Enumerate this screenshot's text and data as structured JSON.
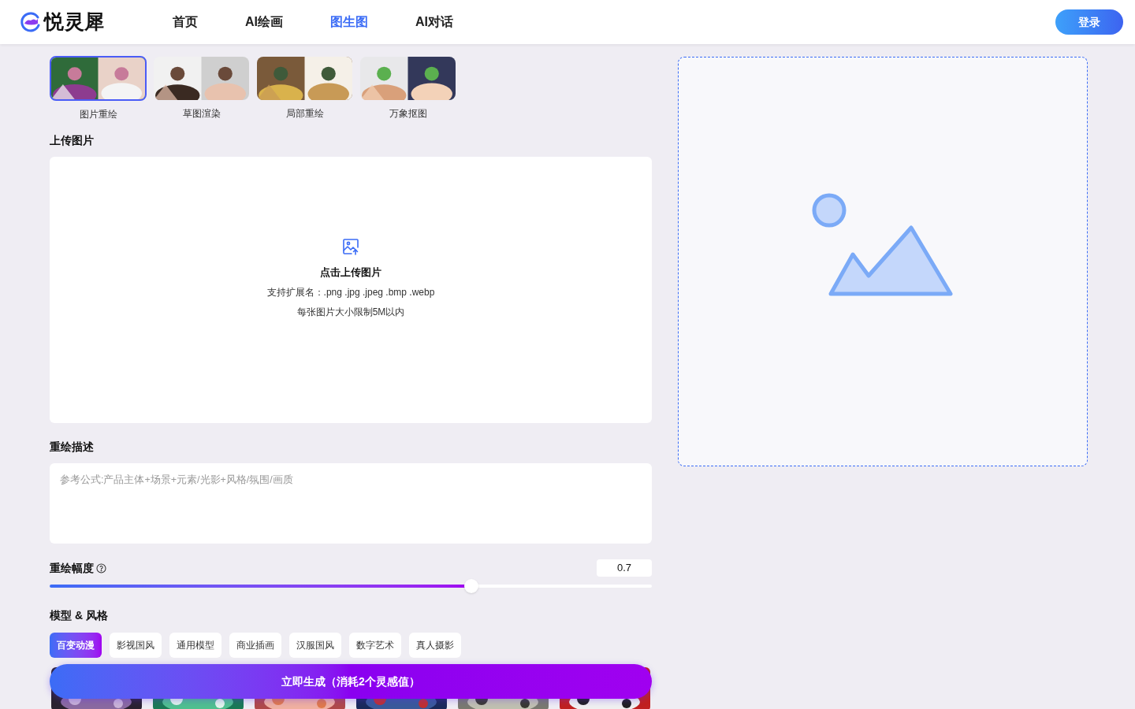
{
  "brand": {
    "name": "悦灵犀"
  },
  "nav": [
    {
      "label": "首页",
      "selected": false
    },
    {
      "label": "AI绘画",
      "selected": false
    },
    {
      "label": "图生图",
      "selected": true
    },
    {
      "label": "AI对话",
      "selected": false
    }
  ],
  "login_button": "登录",
  "modes": [
    {
      "label": "图片重绘",
      "selected": true,
      "kind": "picture"
    },
    {
      "label": "草图渲染",
      "selected": false,
      "kind": "picture"
    },
    {
      "label": "局部重绘",
      "selected": false,
      "kind": "picture"
    },
    {
      "label": "万象抠图",
      "selected": false,
      "kind": "picture"
    }
  ],
  "upload": {
    "title": "上传图片",
    "action": "点击上传图片",
    "formats": "支持扩展名：.png .jpg .jpeg .bmp .webp",
    "limit": "每张图片大小限制5M以内"
  },
  "prompt": {
    "title": "重绘描述",
    "placeholder": "参考公式:产品主体+场景+元素/光影+风格/氛围/画质"
  },
  "strength": {
    "title": "重绘幅度",
    "value": "0.7",
    "level": 0.7
  },
  "styles": {
    "title": "模型 & 风格",
    "tabs": [
      {
        "label": "百变动漫",
        "selected": true
      },
      {
        "label": "影视国风",
        "selected": false
      },
      {
        "label": "通用模型",
        "selected": false
      },
      {
        "label": "商业插画",
        "selected": false
      },
      {
        "label": "汉服国风",
        "selected": false
      },
      {
        "label": "数字艺术",
        "selected": false
      },
      {
        "label": "真人摄影",
        "selected": false
      }
    ]
  },
  "generate_button": "立即生成（消耗2个灵感值）"
}
